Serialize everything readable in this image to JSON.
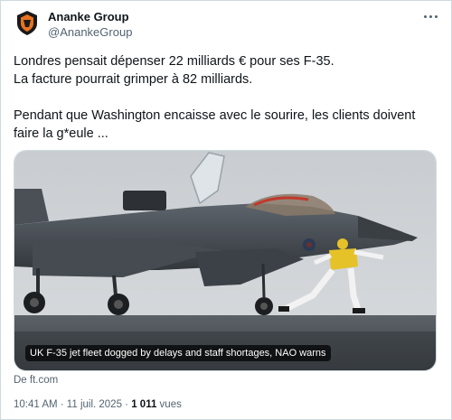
{
  "author": {
    "name": "Ananke Group",
    "handle": "@AnankeGroup"
  },
  "tweet": {
    "line1": "Londres pensait dépenser 22 milliards € pour ses F-35.",
    "line2": "La facture pourrait grimper à 82 milliards.",
    "line3": "Pendant que Washington encaisse avec le sourire, les clients doivent faire la g*eule ..."
  },
  "card": {
    "caption": "UK F-35 jet fleet dogged by delays and staff shortages, NAO warns",
    "source": "De ft.com"
  },
  "meta": {
    "time_date": "10:41 AM · 11 juil. 2025 · ",
    "views_count": "1 011",
    "views_label": " vues"
  },
  "icons": {
    "avatar": "ananke-logo-icon",
    "more": "more-options-icon"
  },
  "colors": {
    "text": "#0f1419",
    "secondary": "#536471",
    "border": "#cfd9de",
    "avatar_orange": "#e8731f"
  }
}
